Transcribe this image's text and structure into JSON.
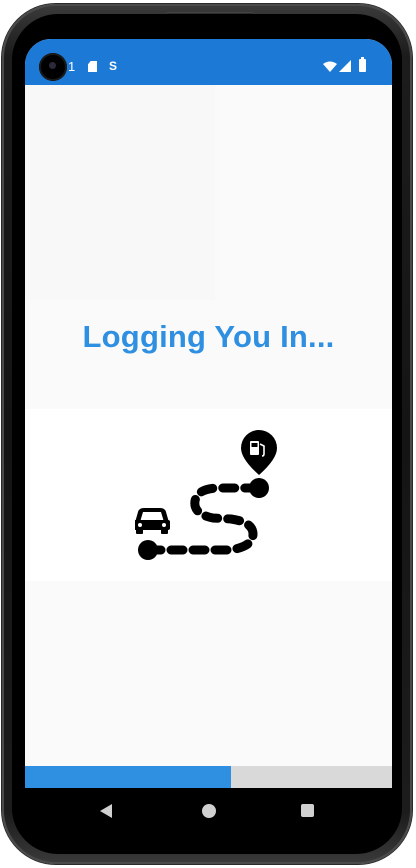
{
  "status_bar": {
    "notification_count": "1",
    "icons": [
      "camera-cutout",
      "sd-card-icon",
      "s-app-icon",
      "wifi-icon",
      "signal-icon",
      "battery-icon"
    ],
    "color": "#1c7ad6"
  },
  "main": {
    "title": "Logging You In...",
    "title_color": "#2f8fe0",
    "illustration_icons": [
      "car-icon",
      "route-path-icon",
      "fuel-location-pin-icon"
    ]
  },
  "progress": {
    "value": 0.56,
    "fill_color": "#2f8fe0",
    "track_color": "#d9d9d9"
  },
  "nav_bar": {
    "buttons": [
      "back-icon",
      "home-icon",
      "recents-icon"
    ]
  }
}
